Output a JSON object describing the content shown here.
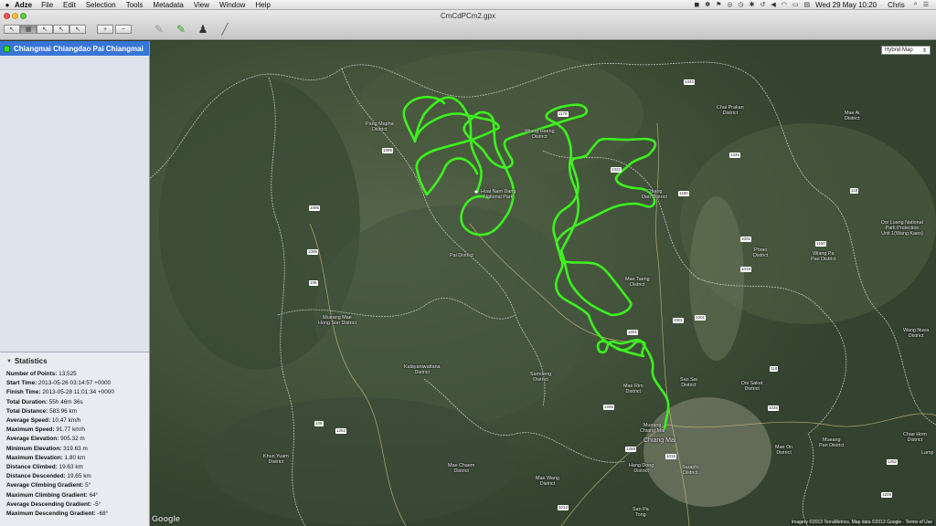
{
  "menubar": {
    "app_name": "Adze",
    "items": [
      "File",
      "Edit",
      "Selection",
      "Tools",
      "Metadata",
      "View",
      "Window",
      "Help"
    ],
    "datetime": "Wed 29 May  10:20",
    "user": "Chris"
  },
  "window": {
    "title": "CmCdPCm2.gpx"
  },
  "toolbar": {
    "plus": "+",
    "minus": "−"
  },
  "sidebar": {
    "track_name": "Chiangmai Chiangdao Pai Chiangmai",
    "stats_title": "Statistics",
    "stats": [
      {
        "label": "Number of Points:",
        "value": "13,525"
      },
      {
        "label": "Start Time:",
        "value": "2013-05-26 03:14:57 +0000"
      },
      {
        "label": "Finish Time:",
        "value": "2013-05-28 11:01:34 +0000"
      },
      {
        "label": "Total Duration:",
        "value": "55h 46m 36s"
      },
      {
        "label": "Total Distance:",
        "value": "583.96 km"
      },
      {
        "label": "Average Speed:",
        "value": "10.47 km/h"
      },
      {
        "label": "Maximum Speed:",
        "value": "91.77 km/h"
      },
      {
        "label": "Average Elevation:",
        "value": "905.32 m"
      },
      {
        "label": "Minimum Elevation:",
        "value": "319.63 m"
      },
      {
        "label": "Maximum Elevation:",
        "value": "1.80 km"
      },
      {
        "label": "Distance Climbed:",
        "value": "19.63 km"
      },
      {
        "label": "Distance Descended:",
        "value": "19.65 km"
      },
      {
        "label": "Average Climbing Gradient:",
        "value": "5°"
      },
      {
        "label": "Maximum Climbing Gradient:",
        "value": "64°"
      },
      {
        "label": "Average Descending Gradient:",
        "value": "-5°"
      },
      {
        "label": "Maximum Descending Gradient:",
        "value": "-68°"
      }
    ]
  },
  "map": {
    "type_selector": "Hybrid Map",
    "track_color": "#3df21f",
    "labels": {
      "pang_mapha": "Pang Mapha\nDistrict",
      "wiang_haeng": "Wiang Haeng\nDistrict",
      "chai_prakan": "Chai Prakan\nDistrict",
      "mae_ai": "Mae Ai\nDistrict",
      "huai_nam_dang": "Huai Nam Dang\nNational Park",
      "chiang_dao": "Chiang\nDao District",
      "pai": "Pai District",
      "mae_taeng": "Mae Taeng\nDistrict",
      "phrao": "Phrao\nDistrict",
      "wiang_pa_pao": "Wiang Pa\nPao District",
      "doi_luang": "Doi Luang National\nPark Protection\nUnit 1(Wang Kaeo)",
      "mueang_mae_hong_son": "Mueang Mae\nHong Son District",
      "kalayaniwattana": "Kalayaniwattana\nDistrict",
      "samoeng": "Samoeng\nDistrict",
      "mae_rim": "Mae Rim\nDistrict",
      "san_sai": "San Sai\nDistrict",
      "doi_saket": "Doi Saket\nDistrict",
      "wang_nuea": "Wang Nuea\nDistrict",
      "mueang_chiang_mai": "Mueang\nChiang Mai",
      "chiang_mai": "Chiang Mai",
      "mae_chaem": "Mae Chaem\nDistrict",
      "khun_yuam": "Khun Yuam\nDistrict",
      "hang_dong": "Hang Dong\nDistrict",
      "saraphi": "Saraphi\nDistrict",
      "mae_on": "Mae On\nDistrict",
      "mueang_pan": "Mueang\nPan District",
      "chae_hom": "Chae Hom\nDistrict",
      "mae_wang": "Mae Wang\nDistrict",
      "lamp": "Lamp",
      "san_pa_tong": "San Pa\nTong"
    },
    "shields": [
      "1178",
      "1095",
      "1095",
      "108",
      "1095",
      "1322",
      "1150",
      "1001",
      "1019",
      "1001",
      "1150",
      "118",
      "1265",
      "1269",
      "108",
      "1263",
      "1013",
      "1001",
      "1001",
      "1035",
      "1346",
      "1340",
      "118",
      "1252",
      "1209",
      "1015"
    ],
    "google": "Google",
    "attribution": "Imagery ©2013 TerraMetrics, Map data ©2013 Google - Terms of Use"
  }
}
